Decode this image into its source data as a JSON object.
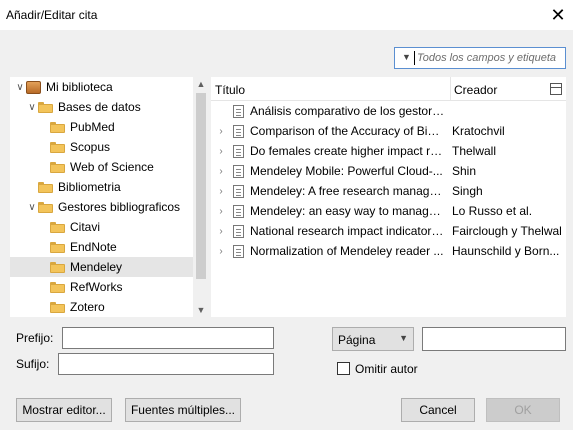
{
  "window": {
    "title": "Añadir/Editar cita",
    "close_glyph": "✕"
  },
  "search": {
    "placeholder": "Todos los campos y etiqueta"
  },
  "tree": {
    "items": [
      {
        "label": "Mi biblioteca",
        "icon": "library-icon",
        "twisty": "∨"
      },
      {
        "label": "Bases de datos",
        "icon": "folder-icon",
        "twisty": "∨"
      },
      {
        "label": "PubMed",
        "icon": "folder-icon"
      },
      {
        "label": "Scopus",
        "icon": "folder-icon"
      },
      {
        "label": "Web of Science",
        "icon": "folder-icon"
      },
      {
        "label": "Bibliometria",
        "icon": "folder-icon"
      },
      {
        "label": "Gestores bibliograficos",
        "icon": "folder-icon",
        "twisty": "∨"
      },
      {
        "label": "Citavi",
        "icon": "folder-icon"
      },
      {
        "label": "EndNote",
        "icon": "folder-icon"
      },
      {
        "label": "Mendeley",
        "icon": "folder-icon",
        "selected": true
      },
      {
        "label": "RefWorks",
        "icon": "folder-icon"
      },
      {
        "label": "Zotero",
        "icon": "folder-icon"
      }
    ]
  },
  "list": {
    "columns": {
      "title": "Título",
      "creator": "Creador"
    },
    "rows": [
      {
        "title": "Análisis comparativo de los gestore...",
        "creator": "",
        "expandable": false
      },
      {
        "title": "Comparison of the Accuracy of Bibl...",
        "creator": "Kratochvil",
        "expandable": true
      },
      {
        "title": "Do females create higher impact re...",
        "creator": "Thelwall",
        "expandable": true
      },
      {
        "title": "Mendeley Mobile: Powerful Cloud-...",
        "creator": "Shin",
        "expandable": true
      },
      {
        "title": "Mendeley: A free research manage...",
        "creator": "Singh",
        "expandable": true
      },
      {
        "title": "Mendeley: an easy way to manage, ...",
        "creator": "Lo Russo et al.",
        "expandable": true
      },
      {
        "title": "National research impact indicators...",
        "creator": "Fairclough y Thelwall",
        "expandable": true
      },
      {
        "title": "Normalization of Mendeley reader ...",
        "creator": "Haunschild y Born...",
        "expandable": true
      }
    ]
  },
  "form": {
    "prefix_label": "Prefijo:",
    "suffix_label": "Sufijo:",
    "locator_value": "Página",
    "omit_author_label": "Omitir autor"
  },
  "buttons": {
    "show_editor": "Mostrar editor...",
    "multiple_sources": "Fuentes múltiples...",
    "cancel": "Cancel",
    "ok": "OK"
  }
}
